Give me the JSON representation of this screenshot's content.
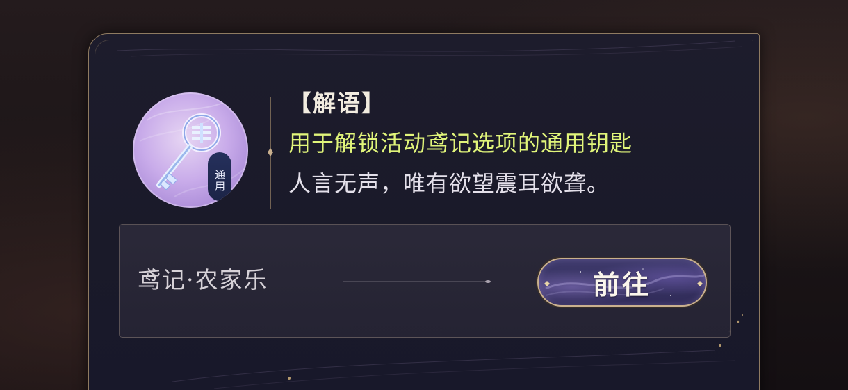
{
  "item": {
    "icon": "key-icon",
    "badge_text": "通用"
  },
  "description": {
    "title": "【解语】",
    "function_text": "用于解锁活动鸢记选项的通用钥匙",
    "flavor_text": "人言无声，唯有欲望震耳欲聋。"
  },
  "source": {
    "name": "鸢记·农家乐",
    "goto_label": "前往"
  },
  "colors": {
    "panel_bg": "#1d1c2c",
    "panel_border": "#8f7b61",
    "function_text": "#e1f57a",
    "flavor_text": "#e4e0ea",
    "button_bg": "#3e3a6c",
    "button_border": "#c9b08e"
  }
}
